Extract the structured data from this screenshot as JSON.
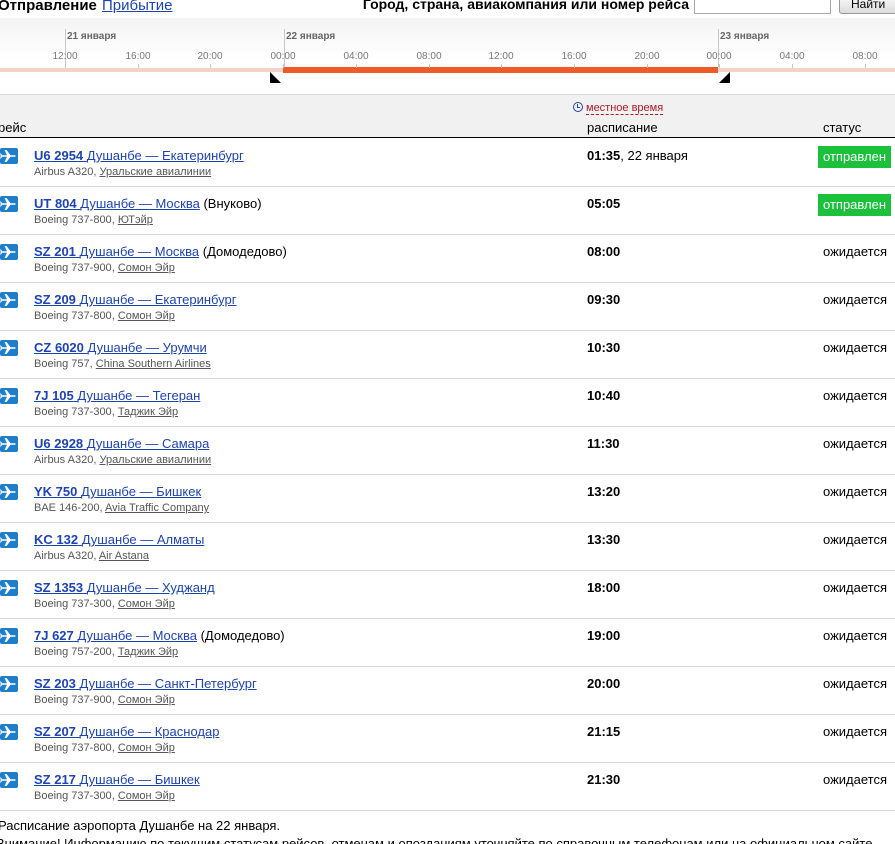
{
  "tabs": {
    "active": "Отправление",
    "other": "Прибытие"
  },
  "search": {
    "label": "Город, страна, авиакомпания или номер рейса",
    "value": "",
    "button": "Найти"
  },
  "timeline": {
    "days": [
      "21 января",
      "22 января",
      "23 января"
    ],
    "hours": [
      "12:00",
      "16:00",
      "20:00",
      "00:00",
      "04:00",
      "08:00",
      "12:00",
      "16:00",
      "20:00",
      "00:00",
      "04:00",
      "08:00"
    ]
  },
  "header": {
    "local_time": "местное время",
    "col_flight": "рейс",
    "col_schedule": "расписание",
    "col_status": "статус"
  },
  "flights": [
    {
      "num": "U6 2954",
      "route": "Душанбе — Екатеринбург",
      "extra": "",
      "aircraft": "Airbus A320",
      "airline": "Уральские авиалинии",
      "time": "01:35",
      "date": ", 22 января",
      "status": "отправлен",
      "departed": true
    },
    {
      "num": "UT 804",
      "route": "Душанбе — Москва",
      "extra": " (Внуково)",
      "aircraft": "Boeing 737-800",
      "airline": "ЮТэйр",
      "time": "05:05",
      "date": "",
      "status": "отправлен",
      "departed": true
    },
    {
      "num": "SZ 201",
      "route": "Душанбе — Москва",
      "extra": " (Домодедово)",
      "aircraft": "Boeing 737-900",
      "airline": "Сомон Эйр",
      "time": "08:00",
      "date": "",
      "status": "ожидается",
      "departed": false
    },
    {
      "num": "SZ 209",
      "route": "Душанбе — Екатеринбург",
      "extra": "",
      "aircraft": "Boeing 737-800",
      "airline": "Сомон Эйр",
      "time": "09:30",
      "date": "",
      "status": "ожидается",
      "departed": false
    },
    {
      "num": "CZ 6020",
      "route": "Душанбе — Урумчи",
      "extra": "",
      "aircraft": "Boeing 757",
      "airline": "China Southern Airlines",
      "time": "10:30",
      "date": "",
      "status": "ожидается",
      "departed": false
    },
    {
      "num": "7J 105",
      "route": "Душанбе — Тегеран",
      "extra": "",
      "aircraft": "Boeing 737-300",
      "airline": "Таджик Эйр",
      "time": "10:40",
      "date": "",
      "status": "ожидается",
      "departed": false
    },
    {
      "num": "U6 2928",
      "route": "Душанбе — Самара",
      "extra": "",
      "aircraft": "Airbus A320",
      "airline": "Уральские авиалинии",
      "time": "11:30",
      "date": "",
      "status": "ожидается",
      "departed": false
    },
    {
      "num": "YK 750",
      "route": "Душанбе — Бишкек",
      "extra": "",
      "aircraft": "BAE 146-200",
      "airline": "Avia Traffic Company",
      "time": "13:20",
      "date": "",
      "status": "ожидается",
      "departed": false
    },
    {
      "num": "KC 132",
      "route": "Душанбе — Алматы",
      "extra": "",
      "aircraft": "Airbus A320",
      "airline": "Air Astana",
      "time": "13:30",
      "date": "",
      "status": "ожидается",
      "departed": false
    },
    {
      "num": "SZ 1353",
      "route": "Душанбе — Худжанд",
      "extra": "",
      "aircraft": "Boeing 737-300",
      "airline": "Сомон Эйр",
      "time": "18:00",
      "date": "",
      "status": "ожидается",
      "departed": false
    },
    {
      "num": "7J 627",
      "route": "Душанбе — Москва",
      "extra": " (Домодедово)",
      "aircraft": "Boeing 757-200",
      "airline": "Таджик Эйр",
      "time": "19:00",
      "date": "",
      "status": "ожидается",
      "departed": false
    },
    {
      "num": "SZ 203",
      "route": "Душанбе — Санкт-Петербург",
      "extra": "",
      "aircraft": "Boeing 737-900",
      "airline": "Сомон Эйр",
      "time": "20:00",
      "date": "",
      "status": "ожидается",
      "departed": false
    },
    {
      "num": "SZ 207",
      "route": "Душанбе — Краснодар",
      "extra": "",
      "aircraft": "Boeing 737-800",
      "airline": "Сомон Эйр",
      "time": "21:15",
      "date": "",
      "status": "ожидается",
      "departed": false
    },
    {
      "num": "SZ 217",
      "route": "Душанбе — Бишкек",
      "extra": "",
      "aircraft": "Boeing 737-300",
      "airline": "Сомон Эйр",
      "time": "21:30",
      "date": "",
      "status": "ожидается",
      "departed": false
    }
  ],
  "footer": {
    "line1": "Расписание аэропорта Душанбе на 22 января.",
    "line2": "Внимание! Информацию по текущим статусам рейсов, отменам и опозданиям уточняйте по справочным телефонам или на официальном сайте"
  },
  "colors": {
    "link": "#1d43b4",
    "departed_bg": "#1bc13b",
    "timeline_range": "#ee5b26",
    "plane_icon": "#1e7ec8"
  }
}
